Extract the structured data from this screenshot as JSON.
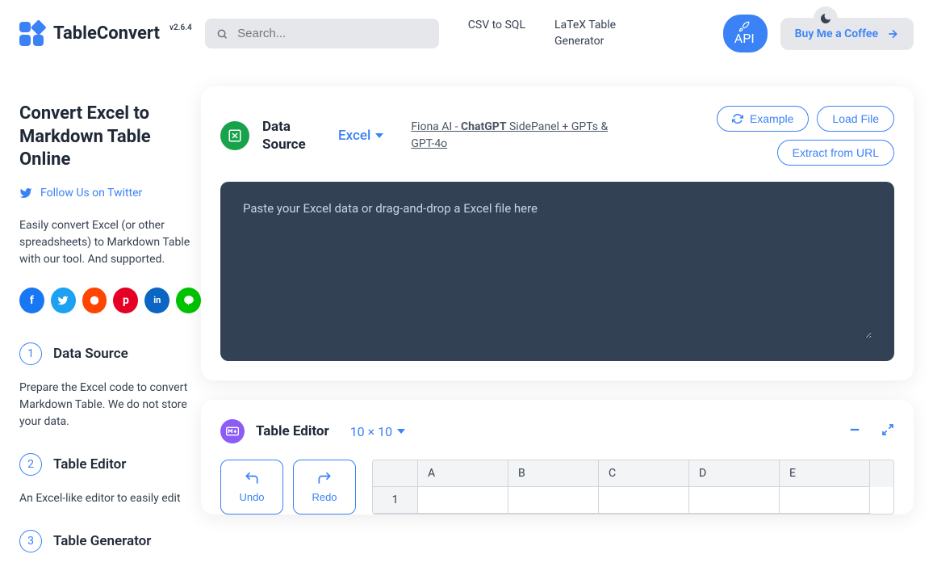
{
  "header": {
    "brand": "TableConvert",
    "version": "v2.6.4",
    "search_placeholder": "Search...",
    "nav": [
      "CSV to SQL",
      "LaTeX Table Generator"
    ],
    "api_label": "API",
    "coffee_label": "Buy Me a Coffee"
  },
  "sidebar": {
    "title": "Convert Excel to Markdown Table Online",
    "twitter": "Follow Us on Twitter",
    "desc": "Easily convert Excel (or other spreadsheets) to Markdown Table with our tool. And supported.",
    "steps": [
      {
        "num": "1",
        "title": "Data Source",
        "desc": "Prepare the Excel code to convert Markdown Table. We do not store your data."
      },
      {
        "num": "2",
        "title": "Table Editor",
        "desc": "An Excel-like editor to easily edit"
      },
      {
        "num": "3",
        "title": "Table Generator",
        "desc": ""
      }
    ]
  },
  "data_source": {
    "label": "Data Source",
    "type": "Excel",
    "promo_prefix": "   Fiona AI - ",
    "promo_bold": "ChatGPT",
    "promo_suffix": " SidePanel + GPTs & GPT-4o",
    "example": "Example",
    "load_file": "Load File",
    "extract_url": "Extract from URL",
    "paste_placeholder": "Paste your Excel data or drag-and-drop a Excel file here"
  },
  "table_editor": {
    "title": "Table Editor",
    "size": "10 × 10",
    "undo": "Undo",
    "redo": "Redo",
    "columns": [
      "A",
      "B",
      "C",
      "D",
      "E"
    ],
    "rows": [
      "1"
    ]
  },
  "socials": [
    {
      "name": "facebook",
      "bg": "#1877f2",
      "letter": "f"
    },
    {
      "name": "twitter",
      "bg": "#1da1f2",
      "letter": ""
    },
    {
      "name": "reddit",
      "bg": "#ff4500",
      "letter": ""
    },
    {
      "name": "pinterest",
      "bg": "#e60023",
      "letter": "p"
    },
    {
      "name": "linkedin",
      "bg": "#0a66c2",
      "letter": "in"
    },
    {
      "name": "line",
      "bg": "#00c300",
      "letter": ""
    }
  ]
}
